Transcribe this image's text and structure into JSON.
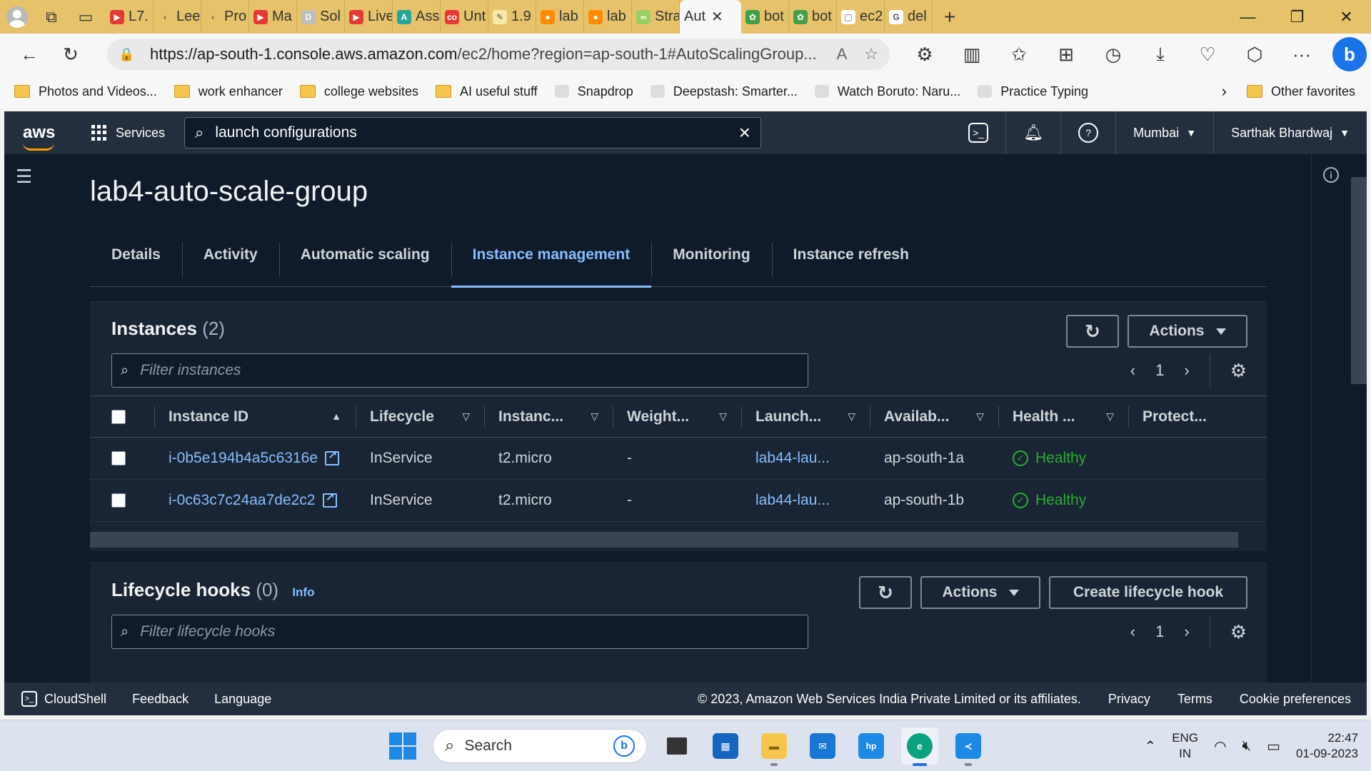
{
  "browser": {
    "tabs": [
      {
        "label": "L7.",
        "color": "#e53935",
        "glyph": "▶"
      },
      {
        "label": "Lee",
        "color": "#e6c36a",
        "glyph": "‹"
      },
      {
        "label": "Pro",
        "color": "#e6c36a",
        "glyph": "‹"
      },
      {
        "label": "Ma",
        "color": "#e53935",
        "glyph": "▶"
      },
      {
        "label": "Sol",
        "color": "#bdbdbd",
        "glyph": "D"
      },
      {
        "label": "Live",
        "color": "#e53935",
        "glyph": "▶"
      },
      {
        "label": "Ass",
        "color": "#26a69a",
        "glyph": "A"
      },
      {
        "label": "Unt",
        "color": "#e53935",
        "glyph": "co"
      },
      {
        "label": "1.9",
        "color": "#f9e7a8",
        "glyph": "✎"
      },
      {
        "label": "lab",
        "color": "#fb8c00",
        "glyph": "●"
      },
      {
        "label": "lab",
        "color": "#fb8c00",
        "glyph": "●"
      },
      {
        "label": "Stra",
        "color": "#9ccc65",
        "glyph": "∞"
      },
      {
        "label": "Aut",
        "color": "#ffffff",
        "glyph": "",
        "active": true
      },
      {
        "label": "bot",
        "color": "#43a047",
        "glyph": "✿"
      },
      {
        "label": "bot",
        "color": "#43a047",
        "glyph": "✿"
      },
      {
        "label": "ec2",
        "color": "#ffffff",
        "glyph": "▢"
      },
      {
        "label": "del",
        "color": "#ffffff",
        "glyph": "G"
      }
    ],
    "url_host": "https://ap-south-1.console.aws.amazon.com",
    "url_path": "/ec2/home?region=ap-south-1#AutoScalingGroup...",
    "favorites": [
      {
        "label": "Photos and Videos...",
        "type": "folder"
      },
      {
        "label": "work enhancer",
        "type": "folder"
      },
      {
        "label": "college websites",
        "type": "folder"
      },
      {
        "label": "AI useful stuff",
        "type": "folder"
      },
      {
        "label": "Snapdrop",
        "type": "site"
      },
      {
        "label": "Deepstash: Smarter...",
        "type": "site"
      },
      {
        "label": "Watch Boruto: Naru...",
        "type": "site"
      },
      {
        "label": "Practice Typing",
        "type": "site"
      }
    ],
    "other_favorites": "Other favorites"
  },
  "aws": {
    "logo": "aws",
    "services": "Services",
    "search_value": "launch configurations",
    "region": "Mumbai",
    "user": "Sarthak Bhardwaj",
    "page_title": "lab4-auto-scale-group",
    "tabs": [
      "Details",
      "Activity",
      "Automatic scaling",
      "Instance management",
      "Monitoring",
      "Instance refresh"
    ],
    "active_tab": "Instance management",
    "instances": {
      "title": "Instances",
      "count": "(2)",
      "filter_placeholder": "Filter instances",
      "actions": "Actions",
      "page": "1",
      "columns": [
        "Instance ID",
        "Lifecycle",
        "Instanc...",
        "Weight...",
        "Launch...",
        "Availab...",
        "Health ...",
        "Protect..."
      ],
      "rows": [
        {
          "id": "i-0b5e194b4a5c6316e",
          "lifecycle": "InService",
          "type": "t2.micro",
          "weight": "-",
          "launch": "lab44-lau...",
          "az": "ap-south-1a",
          "health": "Healthy"
        },
        {
          "id": "i-0c63c7c24aa7de2c2",
          "lifecycle": "InService",
          "type": "t2.micro",
          "weight": "-",
          "launch": "lab44-lau...",
          "az": "ap-south-1b",
          "health": "Healthy"
        }
      ]
    },
    "hooks": {
      "title": "Lifecycle hooks",
      "count": "(0)",
      "info": "Info",
      "actions": "Actions",
      "create": "Create lifecycle hook",
      "filter_placeholder": "Filter lifecycle hooks",
      "page": "1"
    },
    "footer": {
      "cloudshell": "CloudShell",
      "feedback": "Feedback",
      "language": "Language",
      "copyright": "© 2023, Amazon Web Services India Private Limited or its affiliates.",
      "privacy": "Privacy",
      "terms": "Terms",
      "cookies": "Cookie preferences"
    }
  },
  "taskbar": {
    "search": "Search",
    "lang_line1": "ENG",
    "lang_line2": "IN",
    "time": "22:47",
    "date": "01-09-2023"
  },
  "colors": {
    "aws_nav": "#232f3e",
    "aws_bg": "#0f1b2a",
    "link": "#89bdff",
    "healthy": "#29ad32",
    "edge_tabstrip": "#e6c36a"
  }
}
